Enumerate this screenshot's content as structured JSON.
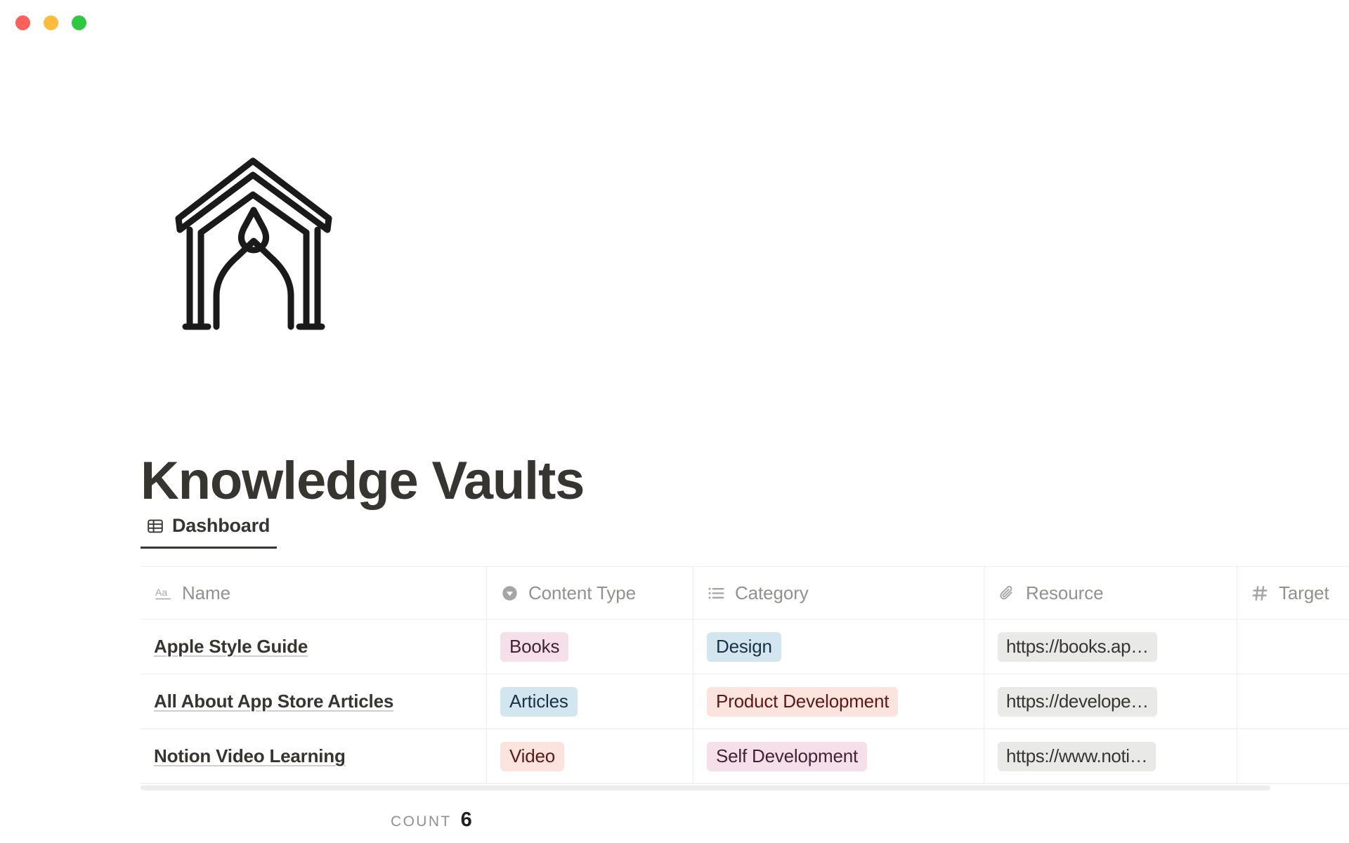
{
  "window": {
    "traffic_lights": [
      {
        "name": "close",
        "color": "#fc6058"
      },
      {
        "name": "minimize",
        "color": "#fdbc40"
      },
      {
        "name": "maximize",
        "color": "#2fc840"
      }
    ]
  },
  "page": {
    "icon": "hand-drawn-shrine-house",
    "title": "Knowledge Vaults"
  },
  "views": [
    {
      "label": "Dashboard",
      "icon": "table-icon",
      "active": true
    }
  ],
  "table": {
    "columns": [
      {
        "key": "name",
        "label": "Name",
        "icon": "text-aa-icon"
      },
      {
        "key": "type",
        "label": "Content Type",
        "icon": "select-circle-icon"
      },
      {
        "key": "category",
        "label": "Category",
        "icon": "multiselect-list-icon"
      },
      {
        "key": "resource",
        "label": "Resource",
        "icon": "paperclip-icon"
      },
      {
        "key": "target",
        "label": "Target",
        "icon": "hash-icon"
      }
    ],
    "rows": [
      {
        "name": "Apple Style Guide",
        "type": {
          "label": "Books",
          "bg": "#f5e0ea",
          "fg": "#442236"
        },
        "category": {
          "label": "Design",
          "bg": "#d3e5ef",
          "fg": "#183347"
        },
        "resource": "https://books.ap…",
        "target": ""
      },
      {
        "name": "All About App Store Articles",
        "type": {
          "label": "Articles",
          "bg": "#d3e5ef",
          "fg": "#183347"
        },
        "category": {
          "label": "Product Development",
          "bg": "#fbe4dd",
          "fg": "#5d1715"
        },
        "resource": "https://develope…",
        "target": ""
      },
      {
        "name": "Notion Video Learning",
        "type": {
          "label": "Video",
          "bg": "#fbe4dd",
          "fg": "#5d1715"
        },
        "category": {
          "label": "Self Development",
          "bg": "#f5e0ea",
          "fg": "#442236"
        },
        "resource": "https://www.noti…",
        "target": ""
      }
    ]
  },
  "footer": {
    "count_label": "Count",
    "count_value": "6"
  }
}
